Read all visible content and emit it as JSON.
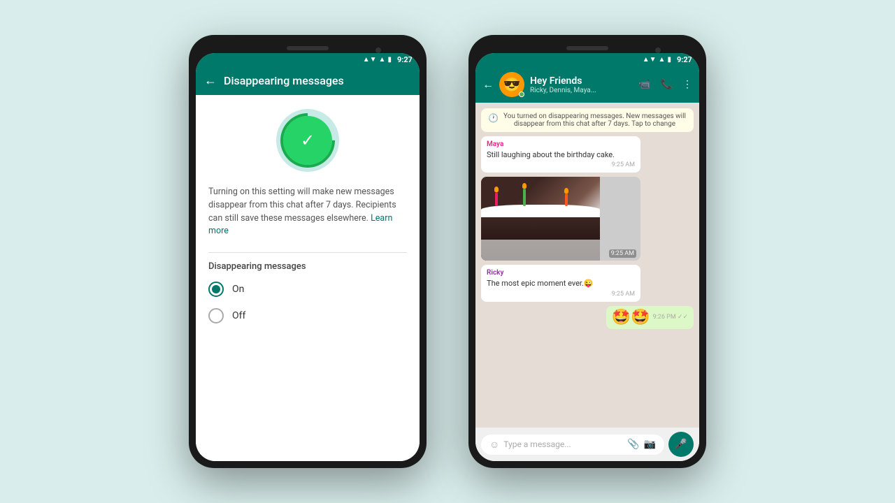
{
  "background_color": "#d9eeec",
  "phone1": {
    "status_bar": {
      "time": "9:27",
      "wifi": "▲▼",
      "signal": "▲▲",
      "battery": "▮"
    },
    "header": {
      "back_label": "←",
      "title": "Disappearing messages"
    },
    "content": {
      "description": "Turning on this setting will make new messages disappear from this chat after 7 days. Recipients can still save these messages elsewhere.",
      "learn_more_label": "Learn more",
      "section_label": "Disappearing messages",
      "options": [
        {
          "value": "on",
          "label": "On",
          "selected": true
        },
        {
          "value": "off",
          "label": "Off",
          "selected": false
        }
      ]
    }
  },
  "phone2": {
    "status_bar": {
      "time": "9:27"
    },
    "header": {
      "back_label": "←",
      "group_name": "Hey Friends",
      "group_subtitle": "Ricky, Dennis, Maya...",
      "avatar_emoji": "😎",
      "actions": {
        "video": "📹",
        "call": "📞",
        "more": "⋮"
      }
    },
    "chat": {
      "system_message": "You turned on disappearing messages. New messages will disappear from this chat after 7 days. Tap to change",
      "messages": [
        {
          "sender": "Maya",
          "sender_color": "#e91e8c",
          "text": "Still laughing about the birthday cake.",
          "time": "9:25 AM",
          "type": "text"
        },
        {
          "type": "image",
          "time": "9:25 AM"
        },
        {
          "sender": "Ricky",
          "sender_color": "#9c27b0",
          "text": "The most epic moment ever.😜",
          "time": "9:25 AM",
          "type": "text"
        },
        {
          "type": "emoji",
          "content": "🤩🤩",
          "time": "9:26 PM",
          "tick": "✓✓"
        }
      ]
    },
    "input_bar": {
      "placeholder": "Type a message...",
      "emoji_icon": "☺",
      "attach_icon": "📎",
      "camera_icon": "📷",
      "mic_icon": "🎤"
    }
  }
}
